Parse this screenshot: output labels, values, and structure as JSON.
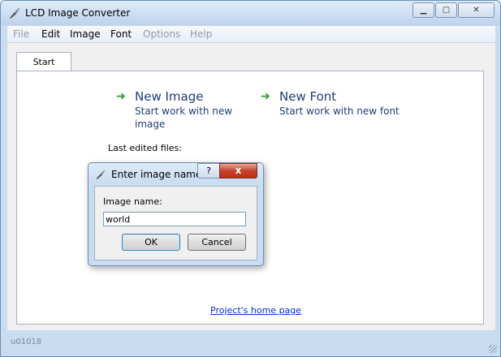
{
  "window": {
    "title": "LCD Image Converter"
  },
  "menu": [
    {
      "label": "File",
      "enabled": false
    },
    {
      "label": "Edit",
      "enabled": true
    },
    {
      "label": "Image",
      "enabled": true
    },
    {
      "label": "Font",
      "enabled": true
    },
    {
      "label": "Options",
      "enabled": false
    },
    {
      "label": "Help",
      "enabled": false
    }
  ],
  "tabs": [
    {
      "label": "Start",
      "active": true
    }
  ],
  "start": {
    "new_image": {
      "title": "New Image",
      "desc_line1": "Start work with new",
      "desc_line2": "image"
    },
    "new_font": {
      "title": "New Font",
      "desc": "Start work with new font"
    },
    "last_edited_label": "Last edited files:",
    "home_link": "Project's home page"
  },
  "dialog": {
    "title": "Enter image name",
    "help_glyph": "?",
    "close_glyph": "x",
    "field_label": "Image name:",
    "field_value": "world",
    "ok_label": "OK",
    "cancel_label": "Cancel"
  },
  "status": {
    "text": "u01018"
  },
  "colors": {
    "arrow": "#2a9a2a",
    "link": "#1f3d7a",
    "close_button": "#c6422c"
  }
}
